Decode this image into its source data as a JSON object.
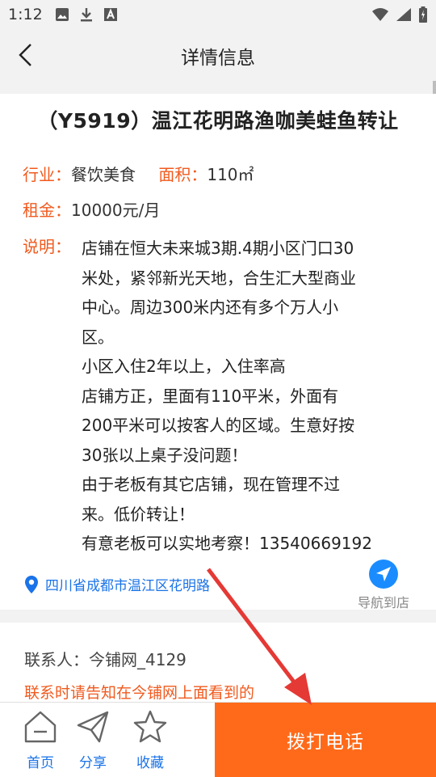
{
  "status_bar": {
    "time": "1:12"
  },
  "header": {
    "title": "详情信息"
  },
  "listing": {
    "title": "（Y5919）温江花明路渔咖美蛙鱼转让",
    "industry_label": "行业：",
    "industry_value": "餐饮美食",
    "area_label": "面积：",
    "area_value": "110㎡",
    "rent_label": "租金：",
    "rent_value": "10000元/月",
    "desc_label": "说明：",
    "desc_lines": [
      "店铺在恒大未来城3期.4期小区门口30",
      "米处，紧邻新光天地，合生汇大型商业",
      "中心。周边300米内还有多个万人小",
      "区。",
      "小区入住2年以上，入住率高",
      "店铺方正，里面有110平米，外面有",
      "200平米可以按客人的区域。生意好按",
      "30张以上桌子没问题！",
      "由于老板有其它店铺，现在管理不过",
      "来。低价转让！",
      "有意老板可以实地考察！13540669192"
    ],
    "address": "四川省成都市温江区花明路",
    "navigate_label": "导航到店"
  },
  "contact": {
    "person": "联系人：今铺网_4129",
    "tip": "联系时请告知在今铺网上面看到的"
  },
  "bottom_bar": {
    "home_label": "首页",
    "share_label": "分享",
    "favorite_label": "收藏",
    "call_label": "拨打电话"
  },
  "colors": {
    "accent": "#f05a1e",
    "call_button": "#ff6a1a",
    "link": "#1a73e8"
  }
}
